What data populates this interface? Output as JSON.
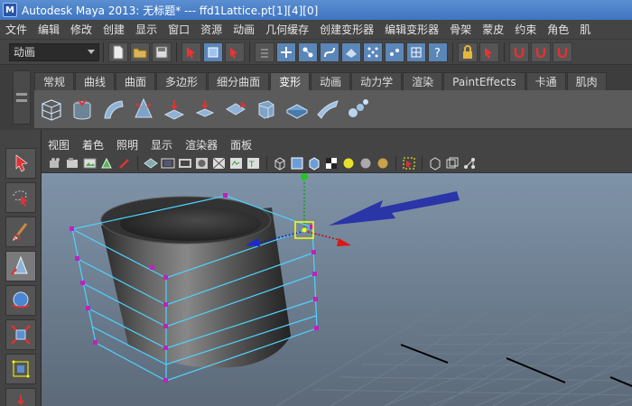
{
  "window": {
    "title": "Autodesk Maya 2013: 无标题*   ---   ffd1Lattice.pt[1][4][0]"
  },
  "menubar": [
    "文件",
    "编辑",
    "修改",
    "创建",
    "显示",
    "窗口",
    "资源",
    "动画",
    "几何缓存",
    "创建变形器",
    "编辑变形器",
    "骨架",
    "蒙皮",
    "约束",
    "角色",
    "肌"
  ],
  "statusline": {
    "mode": "动画"
  },
  "shelf": {
    "tabs": [
      "常规",
      "曲线",
      "曲面",
      "多边形",
      "细分曲面",
      "变形",
      "动画",
      "动力学",
      "渲染",
      "PaintEffects",
      "卡通",
      "肌肉"
    ],
    "active_tab": "变形"
  },
  "panel": {
    "menu": [
      "视图",
      "着色",
      "照明",
      "显示",
      "渲染器",
      "面板"
    ]
  },
  "colors": {
    "selected_point": "#ffff00",
    "lattice": "#4fd2ff",
    "lattice_point": "#c020c0",
    "arrow": "#2a35a8"
  }
}
